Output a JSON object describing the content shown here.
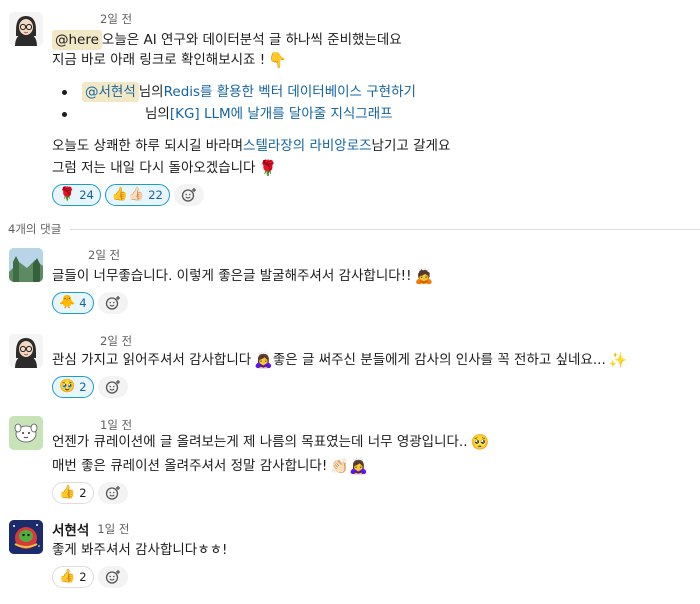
{
  "parent": {
    "time": "2일 전",
    "line1": {
      "here": "@here",
      "text": " 오늘은 AI 연구와 데이터분석 글 하나씩 준비했는데요"
    },
    "line2": {
      "text": "지금 바로 아래 링크로 확인해보시죠 !",
      "emoji": "👇"
    },
    "bullet1": {
      "mention": "@서현석",
      "text": " 님의 ",
      "link": "Redis를 활용한 벡터 데이터베이스 구현하기"
    },
    "bullet2": {
      "text": "님의 ",
      "link": "[KG] LLM에 날개를 달아줄 지식그래프"
    },
    "line3": {
      "text": "오늘도 상쾌한 하루 되시길 바라며 ",
      "link": "스텔라장의 라비앙로즈",
      "after": " 남기고 갈게요"
    },
    "line4": {
      "text": "그럼 저는 내일 다시 돌아오겠습니다",
      "emoji": "🌹"
    },
    "reactions": [
      {
        "emoji": "🌹",
        "count": "24"
      },
      {
        "emoji": "👍👍🏻",
        "count": "22"
      }
    ]
  },
  "replies_label": "4개의 댓글",
  "replies": [
    {
      "time": "2일 전",
      "lines": [
        {
          "text": "글들이 너무좋습니다. 이렇게 좋은글 발굴해주셔서 감사합니다!!",
          "emoji": "🙇"
        }
      ],
      "reactions": [
        {
          "emoji": "🐥",
          "count": "4"
        }
      ]
    },
    {
      "time": "2일 전",
      "lines": [
        {
          "text": "관심 가지고 읽어주셔서 감사합니다",
          "emoji": "🙇‍♀️",
          "text2": " 좋은 글 써주신 분들에게 감사의 인사를 꼭 전하고 싶네요...",
          "emoji2": "✨"
        }
      ],
      "reactions": [
        {
          "emoji": "🥹",
          "count": "2"
        }
      ]
    },
    {
      "time": "1일 전",
      "lines": [
        {
          "text": "언젠가 큐레이션에 글 올려보는게 제 나름의 목표였는데 너무 영광입니다..",
          "emoji": "🥺"
        },
        {
          "text": "매번 좋은 큐레이션 올려주셔서 정말 감사합니다!",
          "emoji": "👏🏻🙇‍♀️"
        }
      ],
      "reactions": [
        {
          "emoji": "👍",
          "count": "2"
        }
      ]
    },
    {
      "author": "서현석",
      "time": "1일 전",
      "lines": [
        {
          "text": "좋게 봐주셔서 감사합니다ㅎㅎ!"
        }
      ],
      "reactions": [
        {
          "emoji": "👍",
          "count": "2"
        }
      ]
    }
  ],
  "colors": {
    "link": "#1264a3",
    "mention_bg": "#f2e8c6",
    "reaction_active_bg": "#e8f5fa",
    "reaction_active_border": "#1d9bd1"
  },
  "icons": {
    "add_reaction": "add-reaction-icon"
  }
}
